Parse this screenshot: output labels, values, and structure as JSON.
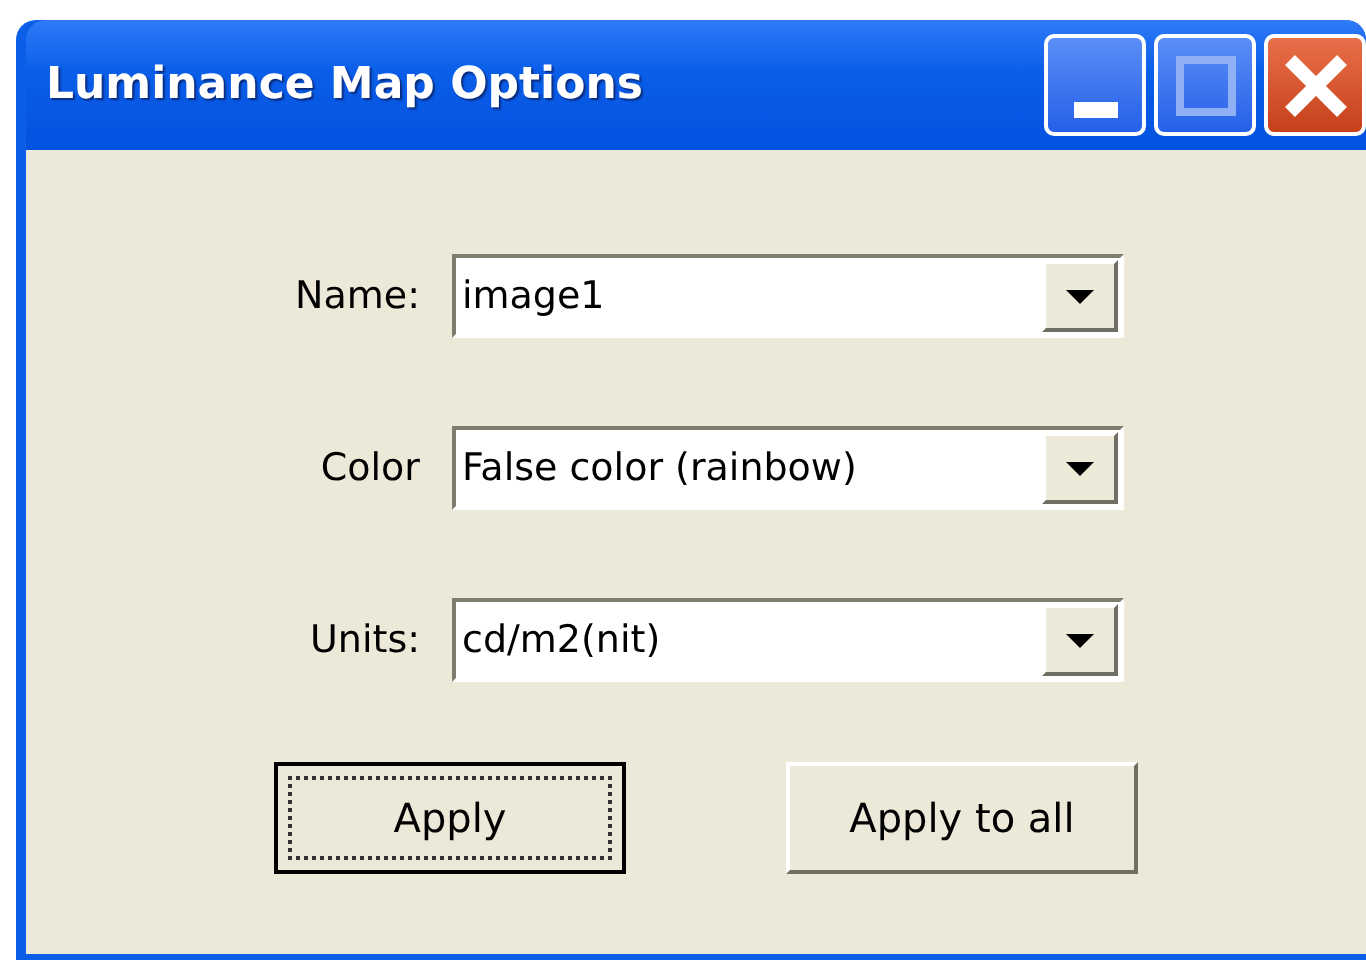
{
  "window": {
    "title": "Luminance Map Options"
  },
  "fields": [
    {
      "label": "Name:",
      "value": "image1"
    },
    {
      "label": "Color",
      "value": "False color (rainbow)"
    },
    {
      "label": "Units:",
      "value": "cd/m2(nit)"
    }
  ],
  "buttons": [
    {
      "label": "Apply",
      "focused": true
    },
    {
      "label": "Apply to all",
      "focused": false
    }
  ]
}
